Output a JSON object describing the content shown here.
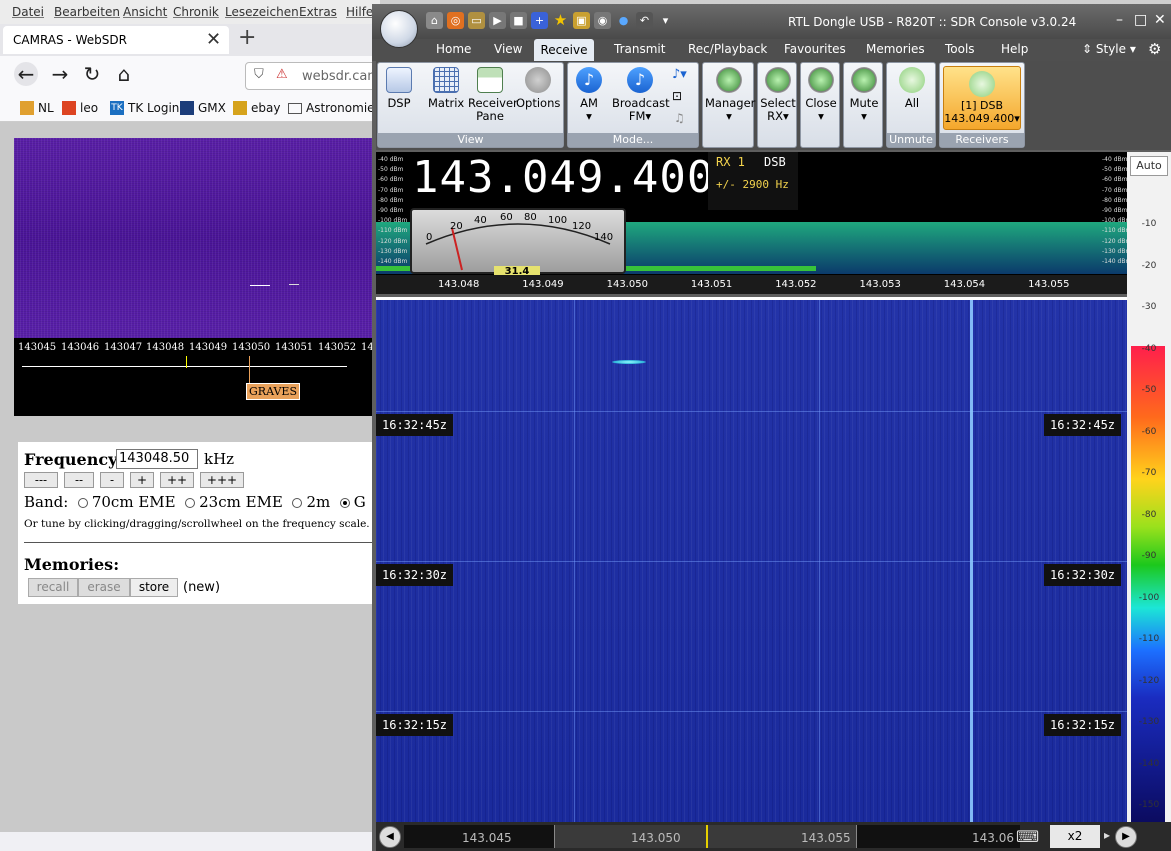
{
  "firefox": {
    "menu": [
      "Datei",
      "Bearbeiten",
      "Ansicht",
      "Chronik",
      "Lesezeichen",
      "Extras",
      "Hilfe"
    ],
    "tab_title": "CAMRAS - WebSDR",
    "url": "websdr.cam",
    "bookmarks": [
      "NL",
      "leo",
      "TK Login",
      "GMX",
      "ebay",
      "Astronomie"
    ],
    "websdr": {
      "scale_ticks": [
        "143045",
        "143046",
        "143047",
        "143048",
        "143049",
        "143050",
        "143051",
        "143052",
        "14"
      ],
      "marker_label": "GRAVES",
      "frequency_label": "Frequency:",
      "frequency_value": "143048.50",
      "frequency_unit": "kHz",
      "step_buttons": [
        "---",
        "--",
        "-",
        "+",
        "++",
        "+++"
      ],
      "band_label": "Band:",
      "bands": [
        {
          "label": "70cm EME",
          "selected": false
        },
        {
          "label": "23cm EME",
          "selected": false
        },
        {
          "label": "2m",
          "selected": false
        },
        {
          "label": "G",
          "selected": true
        }
      ],
      "tune_hint": "Or tune by clicking/dragging/scrollwheel on the frequency scale.",
      "memories_label": "Memories:",
      "memory_buttons": [
        "recall",
        "erase",
        "store"
      ],
      "memory_status": "(new)"
    }
  },
  "sdr": {
    "title": "RTL Dongle USB - R820T :: SDR Console v3.0.24",
    "tabs": [
      "Home",
      "View",
      "Receive",
      "Transmit",
      "Rec/Playback",
      "Favourites",
      "Memories",
      "Tools",
      "Help"
    ],
    "active_tab": "Receive",
    "style_label": "Style",
    "ribbon": {
      "view_group": {
        "label": "View",
        "buttons": [
          "DSP",
          "Matrix",
          "Receiver Pane",
          "Options"
        ]
      },
      "mode_group": {
        "label": "Mode...",
        "buttons": [
          "AM",
          "Broadcast FM"
        ]
      },
      "receivers_buttons": [
        "Manager",
        "Select RX",
        "Close",
        "Mute"
      ],
      "unmute_group": {
        "label": "Unmute",
        "button": "All"
      },
      "receivers_group": {
        "label": "Receivers",
        "button_line1": "[1]  DSB",
        "button_line2": "143.049.400"
      }
    },
    "display": {
      "frequency": "143.049.400",
      "rx": "RX 1",
      "mode": "DSB",
      "bandwidth": "+/- 2900 Hz",
      "smeter_ticks": [
        "0",
        "20",
        "40",
        "60",
        "80",
        "100",
        "120",
        "140"
      ],
      "smeter_value": "31.4",
      "dbm_ticks": [
        "-40 dBm",
        "-50 dBm",
        "-60 dBm",
        "-70 dBm",
        "-80 dBm",
        "-90 dBm",
        "-100 dBm",
        "-110 dBm",
        "-120 dBm",
        "-130 dBm",
        "-140 dBm"
      ],
      "scale_ticks": [
        "143.048",
        "143.049",
        "143.050",
        "143.051",
        "143.052",
        "143.053",
        "143.054",
        "143.055"
      ]
    },
    "waterfall": {
      "timestamps": [
        "16:32:45z",
        "16:32:30z",
        "16:32:15z"
      ]
    },
    "db_bar": {
      "auto_label": "Auto",
      "labels": [
        "-10",
        "-20",
        "-30",
        "-40",
        "-50",
        "-60",
        "-70",
        "-80",
        "-90",
        "-100",
        "-110",
        "-120",
        "-130",
        "-140",
        "-150"
      ]
    },
    "bottom": {
      "ticks": [
        "143.045",
        "143.050",
        "143.055",
        "143.06"
      ],
      "zoom": "x2"
    }
  }
}
